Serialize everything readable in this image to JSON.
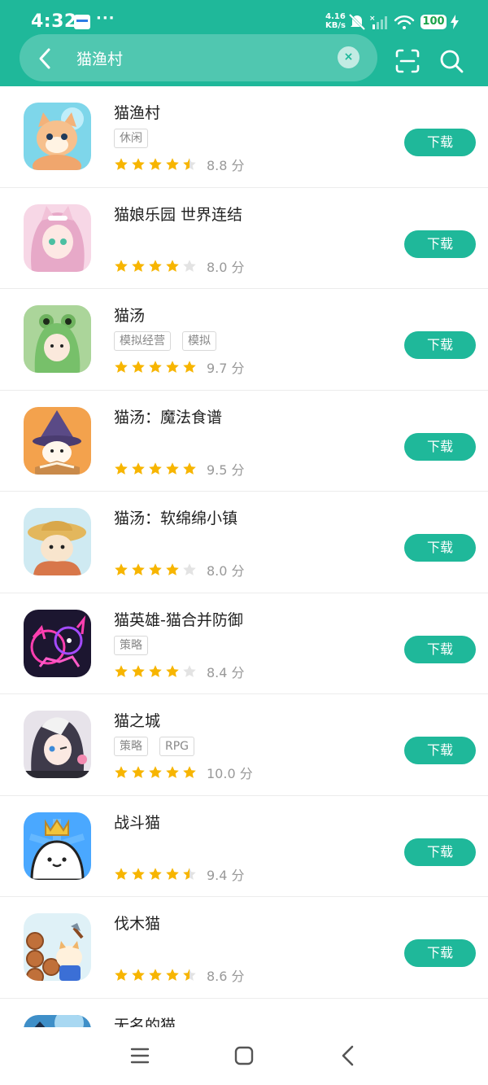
{
  "status_bar": {
    "time": "4:32",
    "more": "···",
    "net_speed_value": "4.16",
    "net_speed_unit": "KB/s",
    "battery": "100"
  },
  "search": {
    "query": "猫渔村",
    "clear_label": "×"
  },
  "colors": {
    "accent": "#1fb89a",
    "star": "#f7b500",
    "star_empty": "#e3e3e3"
  },
  "apps": [
    {
      "name": "猫渔村",
      "tags": [
        "休闲"
      ],
      "stars": 4.5,
      "score": "8.8 分",
      "button": "下载",
      "icon": "cat-fishing-village-icon"
    },
    {
      "name": "猫娘乐园 世界连结",
      "tags": [],
      "stars": 4,
      "score": "8.0 分",
      "button": "下载",
      "icon": "catgirl-park-icon"
    },
    {
      "name": "猫汤",
      "tags": [
        "模拟经营",
        "模拟"
      ],
      "stars": 5,
      "score": "9.7 分",
      "button": "下载",
      "icon": "cat-soup-icon"
    },
    {
      "name": "猫汤：魔法食谱",
      "tags": [],
      "stars": 5,
      "score": "9.5 分",
      "button": "下载",
      "icon": "cat-soup-magic-recipe-icon"
    },
    {
      "name": "猫汤：软绵绵小镇",
      "tags": [],
      "stars": 4,
      "score": "8.0 分",
      "button": "下载",
      "icon": "cat-soup-fluffy-town-icon"
    },
    {
      "name": "猫英雄-猫合并防御",
      "tags": [
        "策略"
      ],
      "stars": 4,
      "score": "8.4 分",
      "button": "下载",
      "icon": "cat-hero-icon"
    },
    {
      "name": "猫之城",
      "tags": [
        "策略",
        "RPG"
      ],
      "stars": 5,
      "score": "10.0 分",
      "button": "下载",
      "icon": "cat-city-icon"
    },
    {
      "name": "战斗猫",
      "tags": [],
      "stars": 4.5,
      "score": "9.4 分",
      "button": "下载",
      "icon": "battle-cats-icon"
    },
    {
      "name": "伐木猫",
      "tags": [],
      "stars": 4.5,
      "score": "8.6 分",
      "button": "下载",
      "icon": "lumberjack-cat-icon"
    },
    {
      "name": "无名的猫",
      "tags": [],
      "stars": 0,
      "score": "",
      "button": "",
      "icon": "nameless-cat-icon"
    }
  ]
}
